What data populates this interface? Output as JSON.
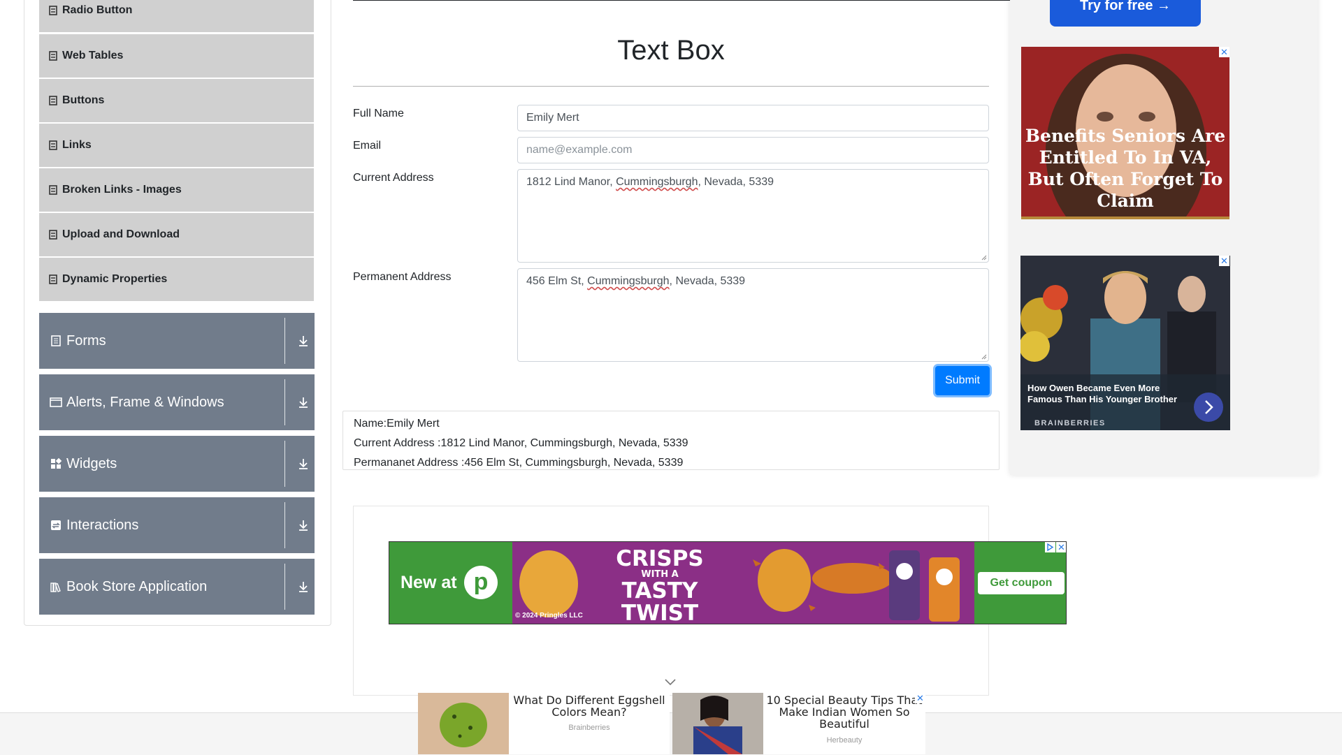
{
  "sidebar": {
    "sub_items": [
      {
        "label": "Radio Button"
      },
      {
        "label": "Web Tables"
      },
      {
        "label": "Buttons"
      },
      {
        "label": "Links"
      },
      {
        "label": "Broken Links - Images"
      },
      {
        "label": "Upload and Download"
      },
      {
        "label": "Dynamic Properties"
      }
    ],
    "groups": [
      {
        "label": "Forms",
        "icon": "form-icon"
      },
      {
        "label": "Alerts, Frame & Windows",
        "icon": "window-icon"
      },
      {
        "label": "Widgets",
        "icon": "widgets-icon"
      },
      {
        "label": "Interactions",
        "icon": "interactions-icon"
      },
      {
        "label": "Book Store Application",
        "icon": "books-icon"
      }
    ]
  },
  "main": {
    "title": "Text Box",
    "form": {
      "full_name_label": "Full Name",
      "full_name_value": "Emily Mert",
      "email_label": "Email",
      "email_placeholder": "name@example.com",
      "current_address_label": "Current Address",
      "current_address": {
        "pre": "1812 Lind Manor, ",
        "city": "Cummingsburgh",
        "post": ", Nevada, 5339"
      },
      "permanent_address_label": "Permanent Address",
      "permanent_address": {
        "pre": "456 Elm St, ",
        "city": "Cummingsburgh",
        "post": ", Nevada, 5339"
      },
      "submit_label": "Submit"
    },
    "output": {
      "name": "Name:Emily Mert",
      "current_address": "Current Address :1812 Lind Manor, Cummingsburgh, Nevada, 5339",
      "permanent_address": "Permananet Address :456 Elm St, Cummingsburgh, Nevada, 5339"
    }
  },
  "ads": {
    "try_button": "Try for free →",
    "ad1_text": "Benefits Seniors Are Entitled To In VA, But Often Forget To Claim",
    "ad2_text": "How Owen Became Even More Famous Than His Younger Brother",
    "ad2_brand": "BRAINBERRIES",
    "banner": {
      "new_at": "New at",
      "logo_letter": "p",
      "crisps": "CRISPS",
      "with_a": "WITH A",
      "tasty": "TASTY",
      "twist": "TWIST",
      "copyright": "© 2024 Pringles LLC",
      "coupon": "Get coupon"
    },
    "bottom": [
      {
        "title": "What Do Different Eggshell Colors Mean?",
        "source": "Brainberries"
      },
      {
        "title": "10 Special Beauty Tips That Make Indian Women So Beautiful",
        "source": "Herbeauty"
      }
    ],
    "close_glyph": "✕"
  },
  "colors": {
    "accent": "#007bff",
    "sidebar_group": "#717c8b",
    "sidebar_item": "#d0d0d0"
  }
}
